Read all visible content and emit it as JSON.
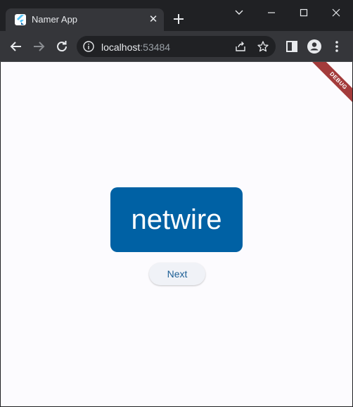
{
  "browser": {
    "tab": {
      "title": "Namer App",
      "close_glyph": "✕",
      "favicon": "flutter-logo-icon"
    },
    "new_tab_icon": "plus-icon",
    "window_controls": [
      "chevron-down-icon",
      "minimize-icon",
      "maximize-icon",
      "close-icon"
    ],
    "toolbar": {
      "back_icon": "arrow-left-icon",
      "forward_icon": "arrow-right-icon",
      "reload_icon": "reload-icon",
      "address": {
        "host": "localhost",
        "port": ":53484",
        "info_icon": "info-icon"
      },
      "share_icon": "share-icon",
      "bookmark_icon": "star-icon",
      "side_panel_icon": "side-panel-icon",
      "profile_icon": "profile-icon",
      "menu_icon": "more-vert-icon"
    }
  },
  "app": {
    "debug_banner": "DEBUG",
    "word": "netwire",
    "next_label": "Next",
    "colors": {
      "card": "#0061a4",
      "card_text": "#ffffff",
      "button_text": "#1c5e95",
      "page_background": "#fcfbfe",
      "debug_banner": "#a33b3b"
    }
  }
}
